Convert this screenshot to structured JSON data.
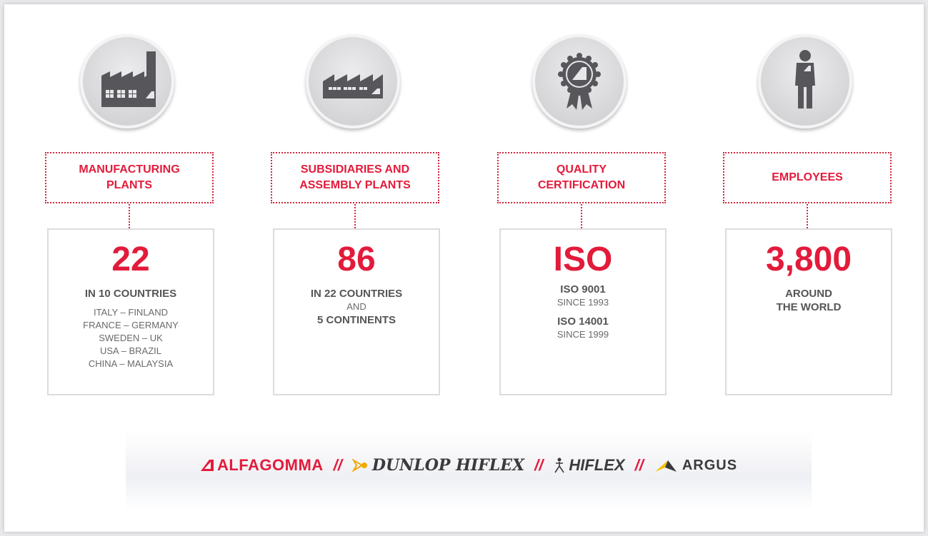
{
  "columns": [
    {
      "icon": "factory-chimney-icon",
      "label": "MANUFACTURING\nPLANTS",
      "number": "22",
      "subtitle": "IN 10 COUNTRIES",
      "lines": [
        "ITALY – FINLAND",
        "FRANCE – GERMANY",
        "SWEDEN – UK",
        "USA – BRAZIL",
        "CHINA – MALAYSIA"
      ]
    },
    {
      "icon": "factory-sawtooth-icon",
      "label": "SUBSIDIARIES AND\nASSEMBLY PLANTS",
      "number": "86",
      "subtitle": "IN 22 COUNTRIES",
      "and": "AND",
      "subtitle2": "5 CONTINENTS"
    },
    {
      "icon": "quality-rosette-icon",
      "label": "QUALITY\nCERTIFICATION",
      "number": "ISO",
      "cert1": "ISO 9001",
      "since1": "SINCE 1993",
      "cert2": "ISO 14001",
      "since2": "SINCE 1999"
    },
    {
      "icon": "employee-person-icon",
      "label": "EMPLOYEES",
      "number": "3,800",
      "subtitle": "AROUND\nTHE WORLD"
    }
  ],
  "brands": {
    "alfagomma": "ALFAGOMMA",
    "separator": "//",
    "dunlop": "DUNLOP HIFLEX",
    "hiflex": "HIFLEX",
    "argus": "ARGUS"
  },
  "colors": {
    "accent": "#e31b3b",
    "text_gray": "#555558",
    "icon_gray": "#57575b"
  }
}
